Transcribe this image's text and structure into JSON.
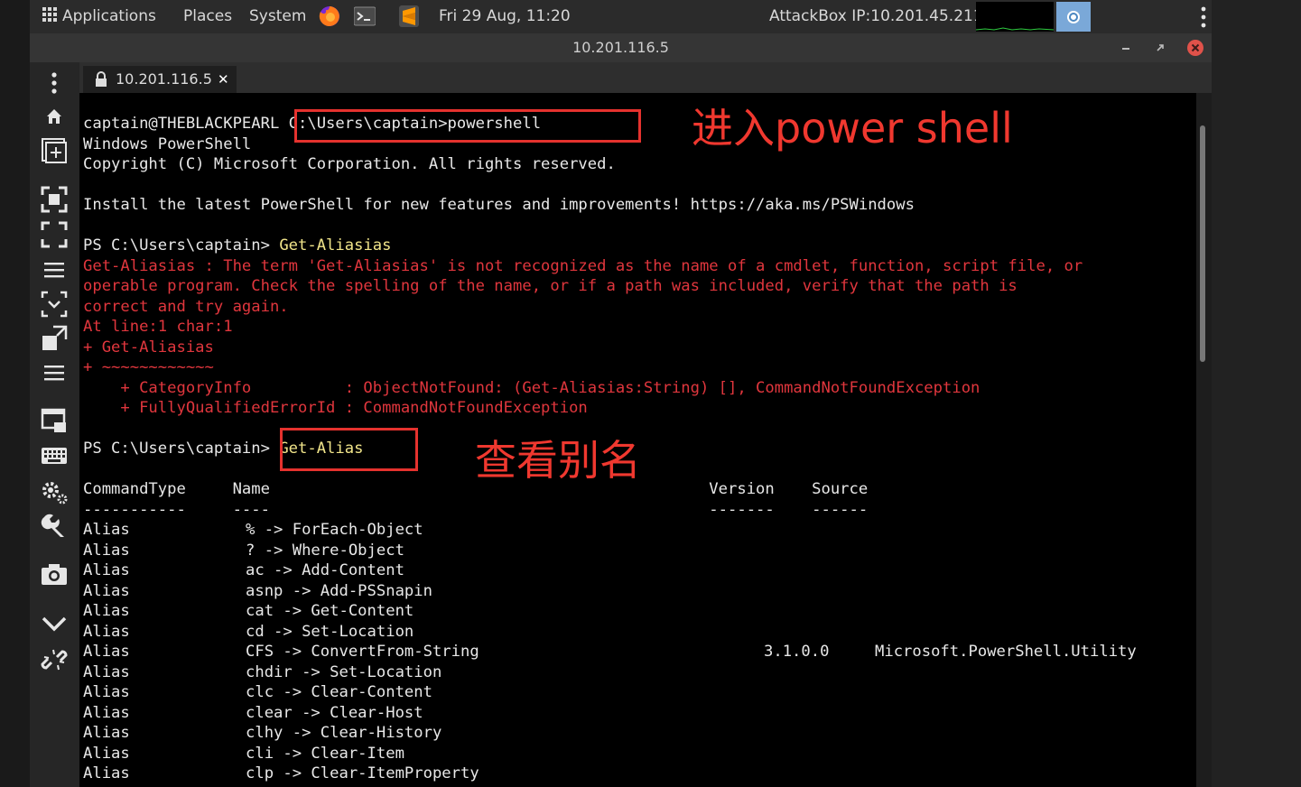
{
  "topbar": {
    "applications_label": "Applications",
    "places_label": "Places",
    "system_label": "System",
    "datetime": "Fri 29 Aug, 11:20",
    "attackbox_label": "AttackBox IP:10.201.45.211"
  },
  "window": {
    "title": "10.201.116.5",
    "tab_label": "10.201.116.5",
    "tab_close": "✕"
  },
  "terminal": {
    "lines": [
      {
        "text": "captain@THEBLACKPEARL C:\\Users\\captain>powershell",
        "color": "normal"
      },
      {
        "text": "Windows PowerShell",
        "color": "normal"
      },
      {
        "text": "Copyright (C) Microsoft Corporation. All rights reserved.",
        "color": "normal"
      },
      {
        "text": "",
        "color": "normal"
      },
      {
        "text": "Install the latest PowerShell for new features and improvements! https://aka.ms/PSWindows",
        "color": "normal"
      },
      {
        "text": "",
        "color": "normal"
      },
      {
        "text": "PS C:\\Users\\captain> ",
        "cmd": "Get-Aliasias",
        "color": "normal"
      },
      {
        "text": "Get-Aliasias : The term 'Get-Aliasias' is not recognized as the name of a cmdlet, function, script file, or",
        "color": "error"
      },
      {
        "text": "operable program. Check the spelling of the name, or if a path was included, verify that the path is",
        "color": "error"
      },
      {
        "text": "correct and try again.",
        "color": "error"
      },
      {
        "text": "At line:1 char:1",
        "color": "error"
      },
      {
        "text": "+ Get-Aliasias",
        "color": "error"
      },
      {
        "text": "+ ~~~~~~~~~~~~",
        "color": "error"
      },
      {
        "text": "    + CategoryInfo          : ObjectNotFound: (Get-Aliasias:String) [], CommandNotFoundException",
        "color": "error"
      },
      {
        "text": "    + FullyQualifiedErrorId : CommandNotFoundException",
        "color": "error"
      },
      {
        "text": "",
        "color": "normal"
      },
      {
        "text": "PS C:\\Users\\captain> ",
        "cmd": "Get-Alias",
        "color": "normal"
      },
      {
        "text": "",
        "color": "normal"
      },
      {
        "text": "CommandType     Name                                               Version    Source",
        "color": "normal"
      },
      {
        "text": "-----------     ----                                               -------    ------",
        "color": "normal"
      }
    ],
    "alias_table": {
      "headers": [
        "CommandType",
        "Name",
        "Version",
        "Source"
      ],
      "rows": [
        {
          "type": "Alias",
          "name": "% -> ForEach-Object",
          "version": "",
          "source": ""
        },
        {
          "type": "Alias",
          "name": "? -> Where-Object",
          "version": "",
          "source": ""
        },
        {
          "type": "Alias",
          "name": "ac -> Add-Content",
          "version": "",
          "source": ""
        },
        {
          "type": "Alias",
          "name": "asnp -> Add-PSSnapin",
          "version": "",
          "source": ""
        },
        {
          "type": "Alias",
          "name": "cat -> Get-Content",
          "version": "",
          "source": ""
        },
        {
          "type": "Alias",
          "name": "cd -> Set-Location",
          "version": "",
          "source": ""
        },
        {
          "type": "Alias",
          "name": "CFS -> ConvertFrom-String",
          "version": "3.1.0.0",
          "source": "Microsoft.PowerShell.Utility"
        },
        {
          "type": "Alias",
          "name": "chdir -> Set-Location",
          "version": "",
          "source": ""
        },
        {
          "type": "Alias",
          "name": "clc -> Clear-Content",
          "version": "",
          "source": ""
        },
        {
          "type": "Alias",
          "name": "clear -> Clear-Host",
          "version": "",
          "source": ""
        },
        {
          "type": "Alias",
          "name": "clhy -> Clear-History",
          "version": "",
          "source": ""
        },
        {
          "type": "Alias",
          "name": "cli -> Clear-Item",
          "version": "",
          "source": ""
        },
        {
          "type": "Alias",
          "name": "clp -> Clear-ItemProperty",
          "version": "",
          "source": ""
        }
      ]
    }
  },
  "annotations": {
    "note_1": "进入power shell",
    "note_2": "查看别名",
    "color": "#e5322e"
  },
  "colors": {
    "terminal_bg": "#000000",
    "error_text": "#e0363d",
    "command_text": "#f1e58a",
    "normal_text": "#e8e8e8"
  },
  "sidebar_icons": [
    "more-vertical-icon",
    "home-icon",
    "add-window-icon",
    "fullscreen-icon",
    "expand-icon",
    "menu-icon",
    "scale-icon",
    "fit-icon",
    "menu-icon",
    "window-icon",
    "keyboard-icon",
    "settings-icon",
    "wrench-icon",
    "camera-icon",
    "chevron-down-icon",
    "disconnect-icon"
  ]
}
